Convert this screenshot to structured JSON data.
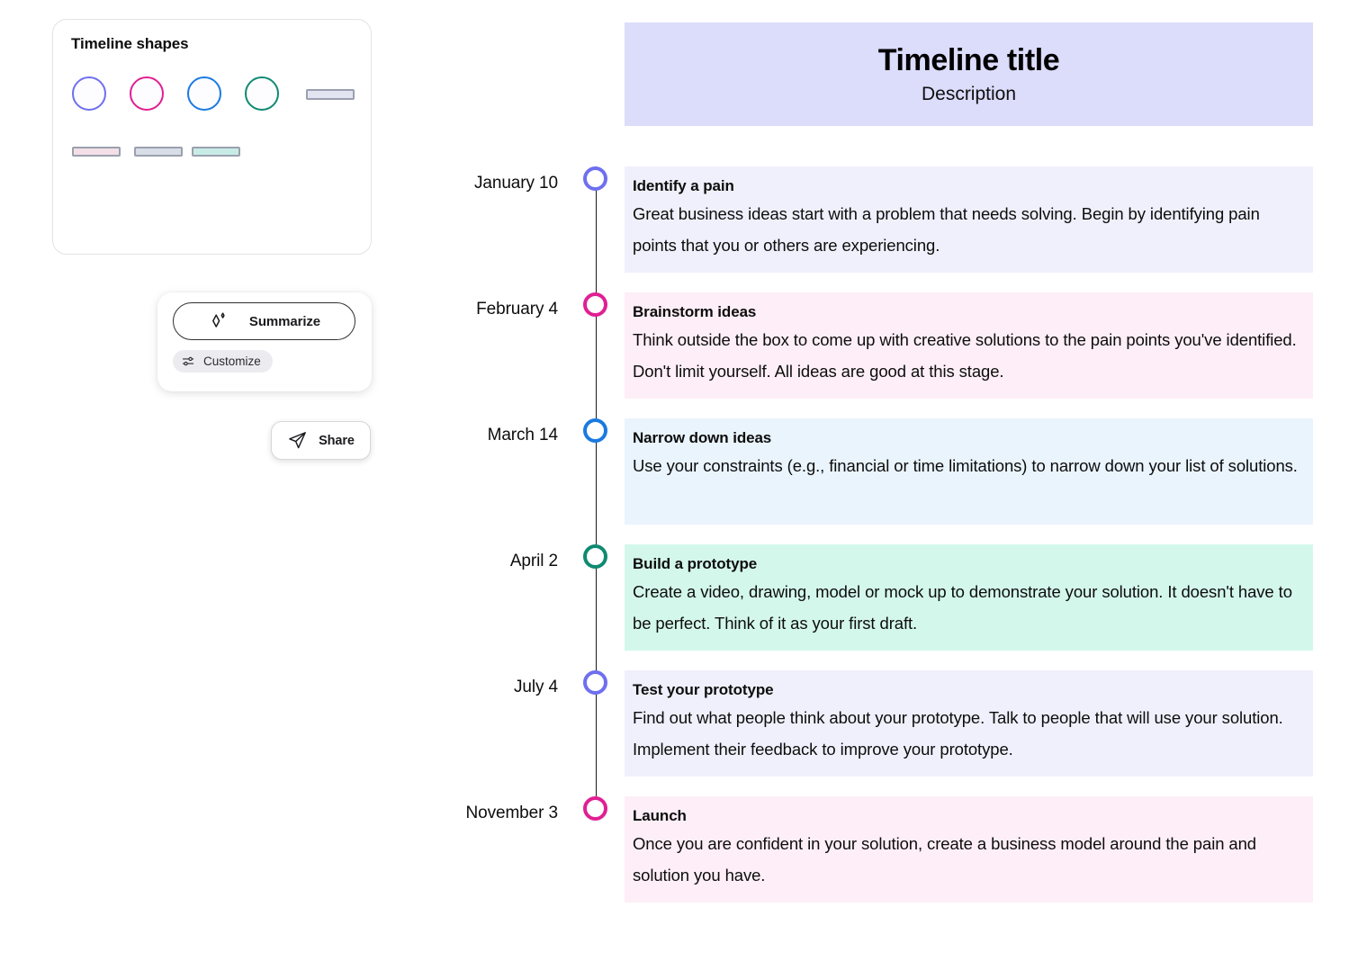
{
  "shapes_panel": {
    "title": "Timeline shapes",
    "circles": [
      {
        "name": "circle-purple",
        "color": "#6f6ff0"
      },
      {
        "name": "circle-magenta",
        "color": "#e01f93"
      },
      {
        "name": "circle-blue",
        "color": "#1b7ae0"
      },
      {
        "name": "circle-teal",
        "color": "#0f8a72"
      }
    ],
    "bars": [
      {
        "name": "bar-lavender",
        "fill": "#e2e4f2",
        "border": "#9aa0ae"
      },
      {
        "name": "bar-pink",
        "fill": "#f4dfe8",
        "border": "#9aa0ae"
      },
      {
        "name": "bar-steel",
        "fill": "#d8dde8",
        "border": "#9aa0ae"
      },
      {
        "name": "bar-mint",
        "fill": "#c8ece5",
        "border": "#9aa0ae"
      }
    ]
  },
  "toolbar": {
    "summarize_label": "Summarize",
    "summarize_icon": "sparkle-icon",
    "customize_label": "Customize",
    "customize_icon": "sliders-icon"
  },
  "share": {
    "label": "Share",
    "icon": "paper-plane-icon"
  },
  "timeline": {
    "title": "Timeline title",
    "description": "Description",
    "header_bg": "#dcdcfb",
    "entries": [
      {
        "date": "January 10",
        "title": "Identify a pain",
        "body": "Great business ideas start with a problem that needs solving. Begin by identifying pain points that you or others are experiencing.",
        "dot_color": "#6f6ff0",
        "card_bg": "#f0f0fc"
      },
      {
        "date": "February 4",
        "title": "Brainstorm ideas",
        "body": "Think outside the box to come up with creative solutions to the pain points you've identified. Don't limit yourself. All ideas are good at this stage.",
        "dot_color": "#e01f93",
        "card_bg": "#fdeef7"
      },
      {
        "date": "March 14",
        "title": "Narrow down ideas",
        "body": "Use your constraints (e.g., financial or time limitations) to narrow down your list of solutions.",
        "dot_color": "#1b7ae0",
        "card_bg": "#eaf4fd"
      },
      {
        "date": "April 2",
        "title": "Build a prototype",
        "body": "Create a video, drawing, model or mock up to demonstrate your solution. It doesn't have to be perfect. Think of it as your first draft.",
        "dot_color": "#0f8a72",
        "card_bg": "#d4f7ec"
      },
      {
        "date": "July 4",
        "title": "Test your prototype",
        "body": "Find out what people think about your prototype. Talk to people that will use your solution. Implement their feedback to improve your prototype.",
        "dot_color": "#6f6ff0",
        "card_bg": "#f0f0fc"
      },
      {
        "date": "November 3",
        "title": "Launch",
        "body": "Once you are confident in your solution, create a business model around the pain and solution you have.",
        "dot_color": "#e01f93",
        "card_bg": "#fdeef7"
      }
    ]
  }
}
